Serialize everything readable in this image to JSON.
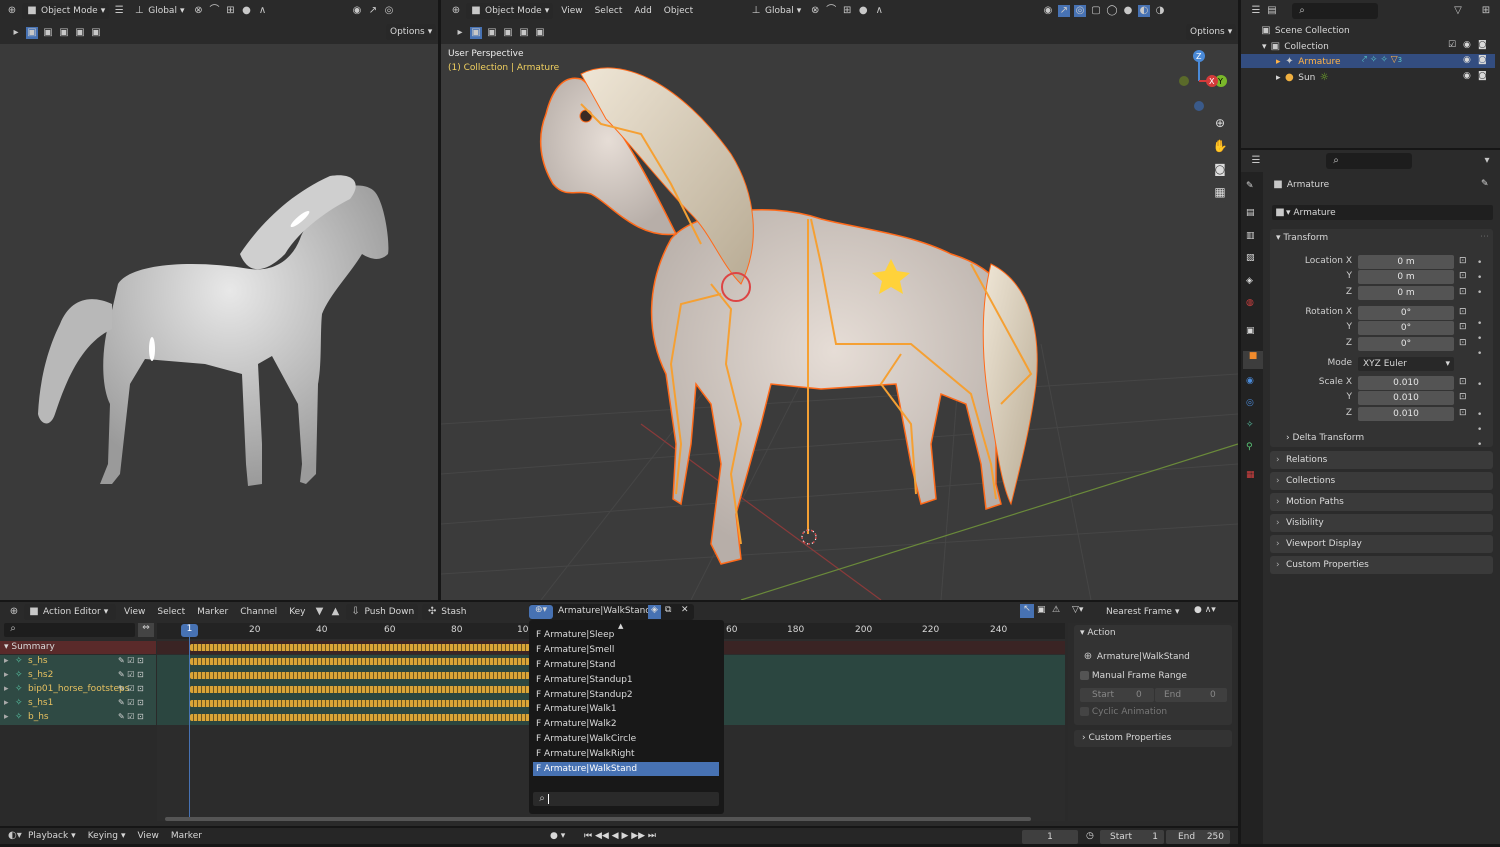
{
  "left_viewport": {
    "mode": "Object Mode",
    "orientation": "Global",
    "options": "Options"
  },
  "main_viewport": {
    "mode": "Object Mode",
    "menu": [
      "View",
      "Select",
      "Add",
      "Object"
    ],
    "orientation": "Global",
    "options": "Options",
    "overlay_title": "User Perspective",
    "overlay_subtitle": "(1) Collection | Armature",
    "gizmo": {
      "x": "X",
      "y": "Y",
      "z": "Z"
    }
  },
  "outliner": {
    "scene_collection": "Scene Collection",
    "collection": "Collection",
    "armature": "Armature",
    "armature_badge": "3",
    "sun": "Sun"
  },
  "properties": {
    "object_name": "Armature",
    "name_field": "Armature",
    "transform_title": "Transform",
    "location_label": "Location X",
    "y": "Y",
    "z": "Z",
    "loc": [
      "0 m",
      "0 m",
      "0 m"
    ],
    "rotation_label": "Rotation X",
    "rot": [
      "0°",
      "0°",
      "0°"
    ],
    "mode_label": "Mode",
    "mode_value": "XYZ Euler",
    "scale_label": "Scale X",
    "scale": [
      "0.010",
      "0.010",
      "0.010"
    ],
    "sections": [
      "Delta Transform",
      "Relations",
      "Collections",
      "Motion Paths",
      "Visibility",
      "Viewport Display",
      "Custom Properties"
    ]
  },
  "action_editor": {
    "editor_type": "Action Editor",
    "menu": [
      "View",
      "Select",
      "Marker",
      "Channel",
      "Key"
    ],
    "push_down": "Push Down",
    "stash": "Stash",
    "action_name": "Armature|WalkStand",
    "snapping": "Nearest Frame",
    "frame_ticks": [
      "1",
      "20",
      "40",
      "60",
      "80",
      "10",
      "60",
      "180",
      "200",
      "220",
      "240"
    ],
    "summary": "Summary",
    "channels": [
      "s_hs",
      "s_hs2",
      "bip01_horse_footsteps",
      "s_hs1",
      "b_hs"
    ]
  },
  "action_menu": {
    "items": [
      "F Armature|Sleep",
      "F Armature|Smell",
      "F Armature|Stand",
      "F Armature|Standup1",
      "F Armature|Standup2",
      "F Armature|Walk1",
      "F Armature|Walk2",
      "F Armature|WalkCircle",
      "F Armature|WalkRight",
      "F Armature|WalkStand"
    ],
    "selected_index": 9
  },
  "action_panel": {
    "title": "Action",
    "action_name": "Armature|WalkStand",
    "manual_range": "Manual Frame Range",
    "start_label": "Start",
    "start_value": "0",
    "end_label": "End",
    "end_value": "0",
    "cyclic": "Cyclic Animation",
    "custom_props": "Custom Properties"
  },
  "timeline": {
    "menu": [
      "Playback",
      "Keying",
      "View",
      "Marker"
    ],
    "current_frame": "1",
    "start_label": "Start",
    "start_value": "1",
    "end_label": "End",
    "end_value": "250"
  },
  "colors": {
    "accent": "#4772b3",
    "orange": "#f08a2c",
    "keyframe": "#d9a437",
    "channel_bg": "#2f4a44"
  }
}
